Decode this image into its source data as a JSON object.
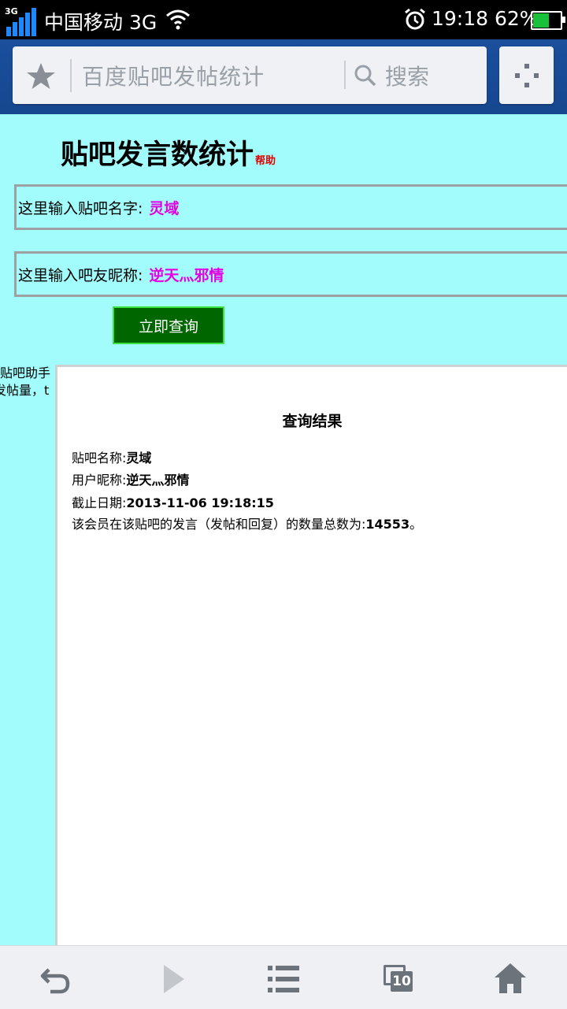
{
  "status_bar": {
    "network_tag": "3G",
    "carrier": "中国移动 3G",
    "time": "19:18",
    "battery": "62%",
    "battery_level": 0.62
  },
  "browser": {
    "url_text": "百度贴吧发帖统计",
    "search_label": "搜索"
  },
  "page": {
    "title": "贴吧发言数统计",
    "help": "帮助",
    "bar_label": "这里输入贴吧名字:",
    "bar_value": "灵域",
    "nick_label": "这里输入吧友昵称:",
    "nick_value": "逆天灬邪情",
    "submit": "立即查询",
    "side_line1": "贴吧助手",
    "side_line2": "发帖量，t"
  },
  "result": {
    "title": "查询结果",
    "bar_name_label": "贴吧名称:",
    "bar_name": "灵域",
    "user_label": "用户昵称:",
    "user": "逆天灬邪情",
    "date_label": "截止日期:",
    "date": "2013-11-06 19:18:15",
    "count_prefix": "该会员在该贴吧的发言（发帖和回复）的数量总数为:",
    "count": "14553",
    "count_suffix": "。"
  },
  "toolbar": {
    "tab_count": "10"
  },
  "colors": {
    "page_bg": "#a3fcfc",
    "accent_value": "#e400e4",
    "submit_bg": "#006600",
    "header_blue": "#1b4f9c"
  }
}
